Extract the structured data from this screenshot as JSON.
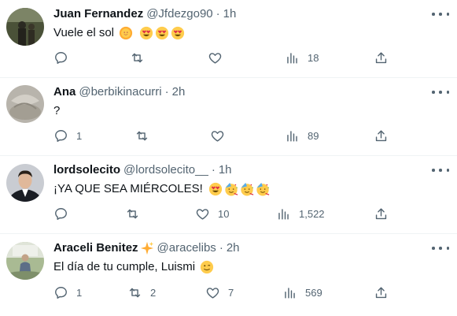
{
  "tweets": [
    {
      "name": "Juan Fernandez",
      "handle": "@Jfdezgo90",
      "separator": "·",
      "time": "1h",
      "text": "Vuele el sol",
      "emojis": [
        "sun-emoji",
        "heart-eyes-emoji",
        "heart-eyes-emoji",
        "heart-eyes-emoji"
      ],
      "replies": "",
      "retweets": "",
      "likes": "",
      "views": "18"
    },
    {
      "name": "Ana",
      "handle": "@berbikinacurri",
      "separator": "·",
      "time": "2h",
      "text": "?",
      "emojis": [],
      "replies": "1",
      "retweets": "",
      "likes": "",
      "views": "89"
    },
    {
      "name": "lordsolecito",
      "handle": "@lordsolecito__",
      "separator": "·",
      "time": "1h",
      "text": "¡YA QUE SEA MIÉRCOLES!",
      "emojis": [
        "heart-eyes-emoji",
        "partying-face-emoji",
        "partying-face-emoji",
        "partying-face-emoji"
      ],
      "replies": "",
      "retweets": "",
      "likes": "10",
      "views": "1,522"
    },
    {
      "name": "Araceli Benitez",
      "name_emoji": "sparkles-emoji",
      "handle": "@aracelibs",
      "separator": "·",
      "time": "2h",
      "text": "El día de tu cumple, Luismi",
      "emojis": [
        "winking-face-emoji"
      ],
      "replies": "1",
      "retweets": "2",
      "likes": "7",
      "views": "569"
    }
  ],
  "colors": {
    "text": "#0f1419",
    "secondary": "#536471",
    "divider": "#eff3f4",
    "emoji_yellow": "#ffcc4d",
    "heart_red": "#dd2e44"
  }
}
